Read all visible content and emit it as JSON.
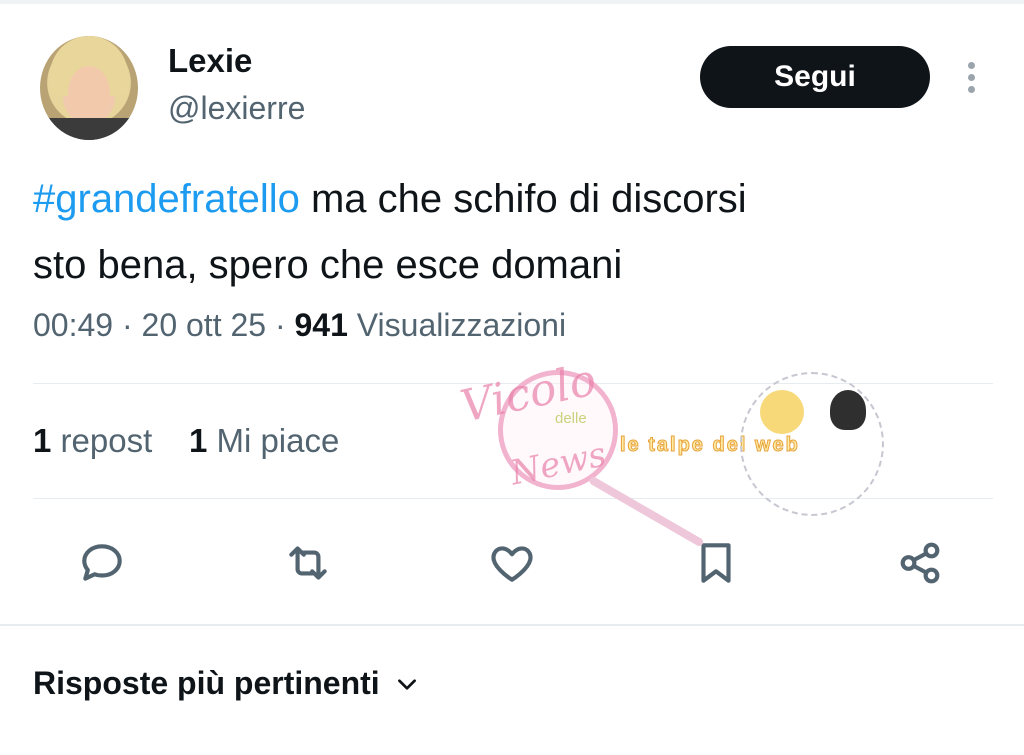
{
  "tweet": {
    "author_name": "Lexie",
    "author_handle": "@lexierre",
    "hashtag": "#grandefratello",
    "text_line1": " ma che schifo di discorsi",
    "text_line2": "sto bena, spero che esce domani",
    "time": "00:49",
    "date": "20 ott 25",
    "views_count": "941",
    "views_label": "Visualizzazioni",
    "reposts_count": "1",
    "reposts_label": "repost",
    "likes_count": "1",
    "likes_label": "Mi piace"
  },
  "header": {
    "follow_label": "Segui"
  },
  "actions": [
    "reply-icon",
    "repost-icon",
    "like-icon",
    "bookmark-icon",
    "share-icon"
  ],
  "replies": {
    "sort_label": "Risposte più pertinenti"
  },
  "watermark": {
    "line1": "Vicolo",
    "line2": "delle",
    "line3": "News",
    "line4": "le talpe del web"
  },
  "colors": {
    "accent": "#1d9bf0",
    "primary_text": "#0f1419",
    "secondary_text": "#536471",
    "button_bg": "#0f1419"
  }
}
